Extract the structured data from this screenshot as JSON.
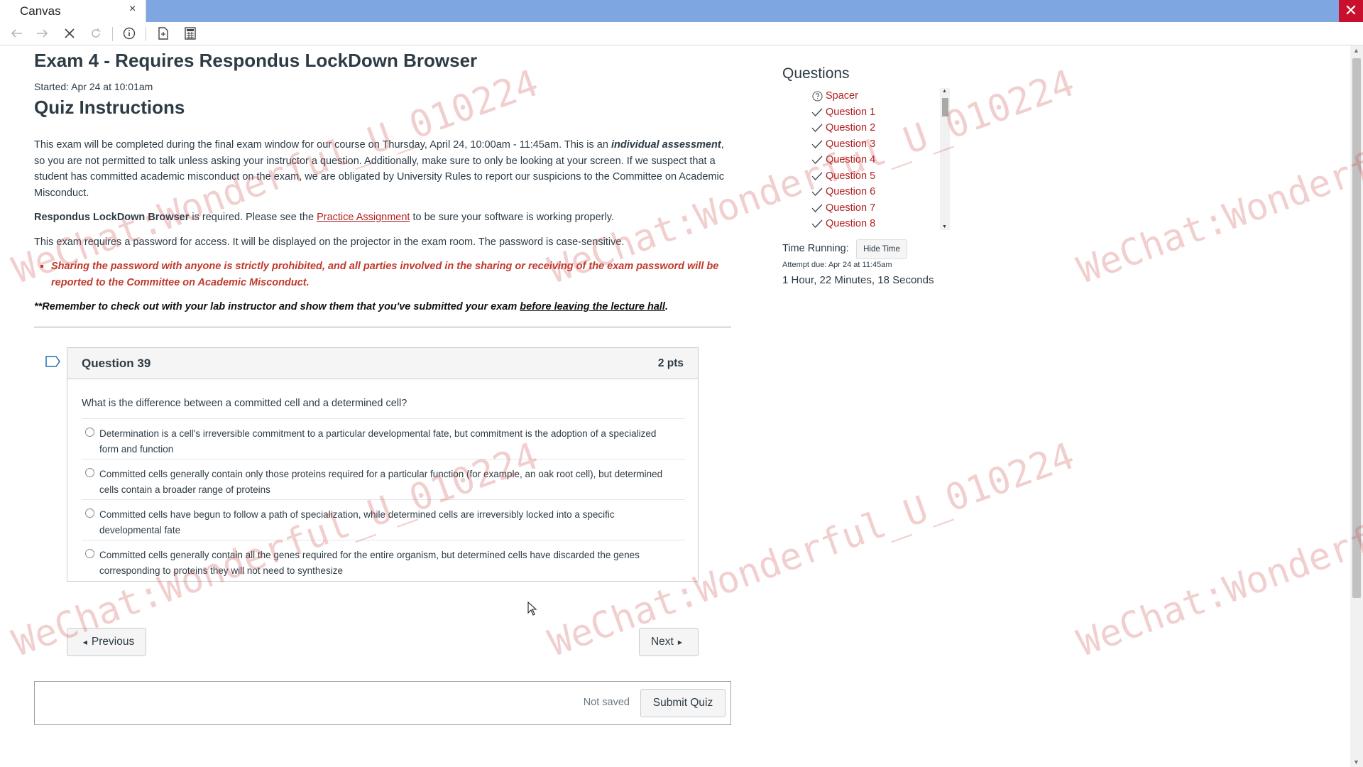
{
  "browser": {
    "tab_title": "Canvas",
    "tab_close": "×",
    "window_close": "✕"
  },
  "exam": {
    "title": "Exam 4 - Requires Respondus LockDown Browser",
    "started": "Started: Apr 24 at 10:01am",
    "instructions_title": "Quiz Instructions",
    "p1_a": "This exam will be completed during the final exam window for our course on Thursday, April 24, 10:00am - 11:45am.  This is an ",
    "p1_em": "individual assessment",
    "p1_b": ", so you are not permitted to talk unless asking your instructor a question.  Additionally, make sure to only be looking at your screen.  If we suspect that a student has committed academic misconduct on the exam, we are obligated by University Rules to report our suspicions to the Committee on Academic Misconduct.",
    "p2_bold": "Respondus LockDown Browser",
    "p2_a": " is required. Please see the ",
    "p2_link": "Practice Assignment",
    "p2_b": " to be sure your software is working properly.",
    "p3": "This exam requires a password for access. It will be displayed on the projector in the exam room. The password is case-sensitive.",
    "warning": "Sharing the password with anyone is strictly prohibited, and all parties involved in the sharing or receiving of the exam password will be reported to the Committee on Academic Misconduct.",
    "remember_a": "**Remember to check out with your lab instructor and show them that you've submitted your exam ",
    "remember_link": "before leaving the lecture hall",
    "remember_b": "."
  },
  "question": {
    "name": "Question 39",
    "points": "2 pts",
    "text": "What is the difference between a committed cell and a determined cell?",
    "answers": [
      "Determination is a cell's irreversible commitment to a particular developmental fate, but commitment is the adoption of a specialized form and function",
      "Committed cells generally contain only those proteins required for a particular function (for example, an oak root cell), but determined cells contain a broader range of proteins",
      "Committed cells have begun to follow a path of specialization, while determined cells are irreversibly locked into a specific developmental fate",
      "Committed cells generally contain all the genes required for the entire organism, but determined cells have discarded the genes corresponding to proteins they will not need to synthesize"
    ]
  },
  "nav": {
    "previous": "Previous",
    "next": "Next",
    "not_saved": "Not saved",
    "submit": "Submit Quiz"
  },
  "sidebar": {
    "heading": "Questions",
    "items": [
      {
        "label": "Spacer",
        "icon": "question-circle-icon"
      },
      {
        "label": "Question 1",
        "icon": "check-icon"
      },
      {
        "label": "Question 2",
        "icon": "check-icon"
      },
      {
        "label": "Question 3",
        "icon": "check-icon"
      },
      {
        "label": "Question 4",
        "icon": "check-icon"
      },
      {
        "label": "Question 5",
        "icon": "check-icon"
      },
      {
        "label": "Question 6",
        "icon": "check-icon"
      },
      {
        "label": "Question 7",
        "icon": "check-icon"
      },
      {
        "label": "Question 8",
        "icon": "check-icon"
      }
    ],
    "time_running": "Time Running:",
    "hide_time": "Hide Time",
    "attempt_due": "Attempt due: Apr 24 at 11:45am",
    "time_remaining": "1 Hour, 22 Minutes, 18 Seconds"
  },
  "watermark": "WeChat:Wonderful_U_010224",
  "colors": {
    "titlebar": "#7ea6e0",
    "link": "#b21f1f",
    "warning": "#c0392b",
    "text": "#2d3b45",
    "close_button": "#c8102e"
  }
}
